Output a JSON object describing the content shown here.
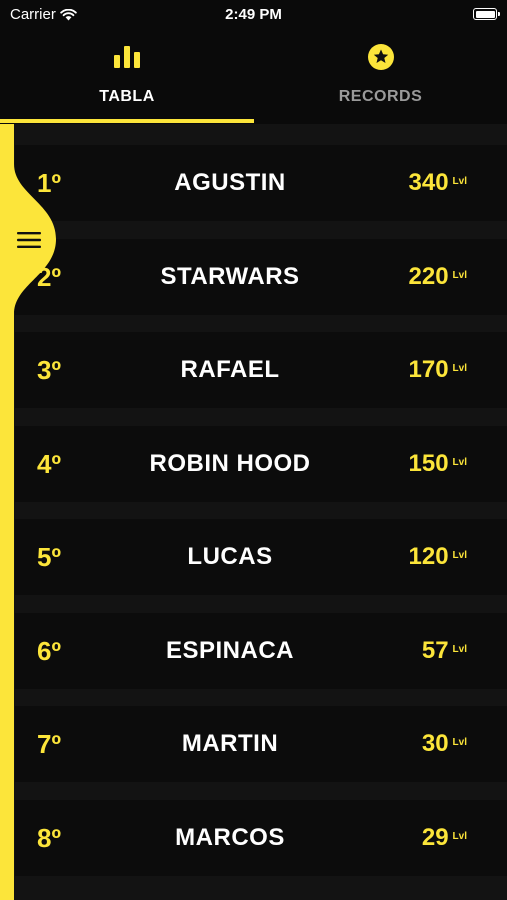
{
  "status_bar": {
    "carrier": "Carrier",
    "time": "2:49 PM"
  },
  "tabs": [
    {
      "label": "TABLA",
      "icon": "bar-chart-icon",
      "active": true
    },
    {
      "label": "RECORDS",
      "icon": "star-icon",
      "active": false
    }
  ],
  "colors": {
    "accent": "#fce53a",
    "background": "#111111",
    "row": "#0c0c0c",
    "inactive_tab": "#9a9a9a"
  },
  "ranking": [
    {
      "rank": "1º",
      "name": "AGUSTIN",
      "level": "340",
      "unit": "Lvl"
    },
    {
      "rank": "2º",
      "name": "STARWARS",
      "level": "220",
      "unit": "Lvl"
    },
    {
      "rank": "3º",
      "name": "RAFAEL",
      "level": "170",
      "unit": "Lvl"
    },
    {
      "rank": "4º",
      "name": "ROBIN HOOD",
      "level": "150",
      "unit": "Lvl"
    },
    {
      "rank": "5º",
      "name": "LUCAS",
      "level": "120",
      "unit": "Lvl"
    },
    {
      "rank": "6º",
      "name": "ESPINACA",
      "level": "57",
      "unit": "Lvl"
    },
    {
      "rank": "7º",
      "name": "MARTIN",
      "level": "30",
      "unit": "Lvl"
    },
    {
      "rank": "8º",
      "name": "MARCOS",
      "level": "29",
      "unit": "Lvl"
    }
  ],
  "side_menu": {
    "icon": "hamburger-menu-icon"
  }
}
